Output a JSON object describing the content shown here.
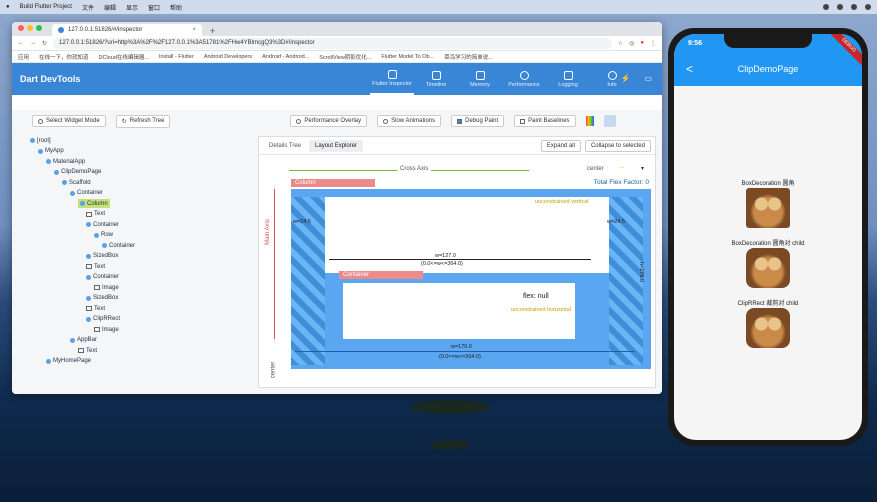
{
  "menubar": {
    "app": "Build Flutter Project",
    "items": [
      "文件",
      "编辑",
      "显示",
      "窗口",
      "帮助"
    ]
  },
  "browser": {
    "tab_title": "127.0.0.1:51826/#/inspector",
    "tab_close": "×",
    "new_tab": "+",
    "url": "127.0.0.1:51826/?uri=http%3A%2F%2F127.0.0.1%3A51781%2FHw4YBlmcgQ3%3D#/inspector",
    "bookmarks": [
      "应用",
      "在线一下，你就知道",
      "DCloud在线编辑器...",
      "Install - Flutter",
      "Android Developers",
      "Android - Android...",
      "ScrollView阴影优化...",
      "Flutter Model To Ob...",
      "菜鸟学习的简单说..."
    ]
  },
  "devtools": {
    "title": "Dart DevTools",
    "tools": [
      {
        "label": "Flutter Inspector",
        "icon": "inspector-icon"
      },
      {
        "label": "Timeline",
        "icon": "timeline-icon"
      },
      {
        "label": "Memory",
        "icon": "memory-icon"
      },
      {
        "label": "Performance",
        "icon": "performance-icon"
      },
      {
        "label": "Logging",
        "icon": "logging-icon"
      },
      {
        "label": "Info",
        "icon": "info-icon"
      }
    ]
  },
  "toolbar": {
    "select_widget": "Select Widget Mode",
    "refresh_tree": "Refresh Tree",
    "performance_overlay": "Performance Overlay",
    "slow_animations": "Slow Animations",
    "debug_paint": "Debug Paint",
    "paint_baselines": "Paint Baselines"
  },
  "tree": [
    {
      "label": "[root]",
      "depth": 0,
      "kind": "node"
    },
    {
      "label": "MyApp",
      "depth": 1,
      "kind": "node"
    },
    {
      "label": "MaterialApp",
      "depth": 2,
      "kind": "node"
    },
    {
      "label": "ClipDemoPage",
      "depth": 3,
      "kind": "node"
    },
    {
      "label": "Scaffold",
      "depth": 4,
      "kind": "node"
    },
    {
      "label": "Container",
      "depth": 5,
      "kind": "node"
    },
    {
      "label": "Column",
      "depth": 6,
      "kind": "node",
      "selected": true
    },
    {
      "label": "Text",
      "depth": 7,
      "kind": "text"
    },
    {
      "label": "Container",
      "depth": 7,
      "kind": "node"
    },
    {
      "label": "Row",
      "depth": 8,
      "kind": "node"
    },
    {
      "label": "Container",
      "depth": 9,
      "kind": "node"
    },
    {
      "label": "SizedBox",
      "depth": 7,
      "kind": "node"
    },
    {
      "label": "Text",
      "depth": 7,
      "kind": "text"
    },
    {
      "label": "Container",
      "depth": 7,
      "kind": "node"
    },
    {
      "label": "Image",
      "depth": 8,
      "kind": "image"
    },
    {
      "label": "SizedBox",
      "depth": 7,
      "kind": "node"
    },
    {
      "label": "Text",
      "depth": 7,
      "kind": "text"
    },
    {
      "label": "ClipRRect",
      "depth": 7,
      "kind": "node"
    },
    {
      "label": "Image",
      "depth": 8,
      "kind": "image"
    },
    {
      "label": "AppBar",
      "depth": 5,
      "kind": "node"
    },
    {
      "label": "Text",
      "depth": 6,
      "kind": "text"
    },
    {
      "label": "MyHomePage",
      "depth": 2,
      "kind": "node"
    }
  ],
  "panel": {
    "tabs": [
      "Details Tree",
      "Layout Explorer"
    ],
    "expand_all": "Expand all",
    "collapse": "Collapse to selected",
    "cross_axis": "Cross Axis",
    "cross_value": "center",
    "main_axis": "Main Axis",
    "main_value": "center",
    "total_flex": "Total Flex Factor: 0",
    "column_label": "Column",
    "container_label": "Container",
    "w_left": "w=24.5",
    "w_right": "w=24.5",
    "inner_w": "w=127.0",
    "inner_constraint": "(0.0<=w<=364.0)",
    "outer_w": "w=176.0",
    "outer_constraint": "(0.0<=w<=364.0)",
    "h_label": "h=176.0",
    "flex_null": "flex: null",
    "unconstrained": "unconstrained vertical",
    "unconstrained2": "unconstrained horizontal"
  },
  "phone": {
    "time": "9:56",
    "title": "ClipDemoPage",
    "back": "<",
    "debug": "DEBUG",
    "labels": [
      "BoxDecoration 圆角",
      "BoxDecoration 圆角对 child",
      "ClipRRect 裁剪对 child"
    ]
  }
}
